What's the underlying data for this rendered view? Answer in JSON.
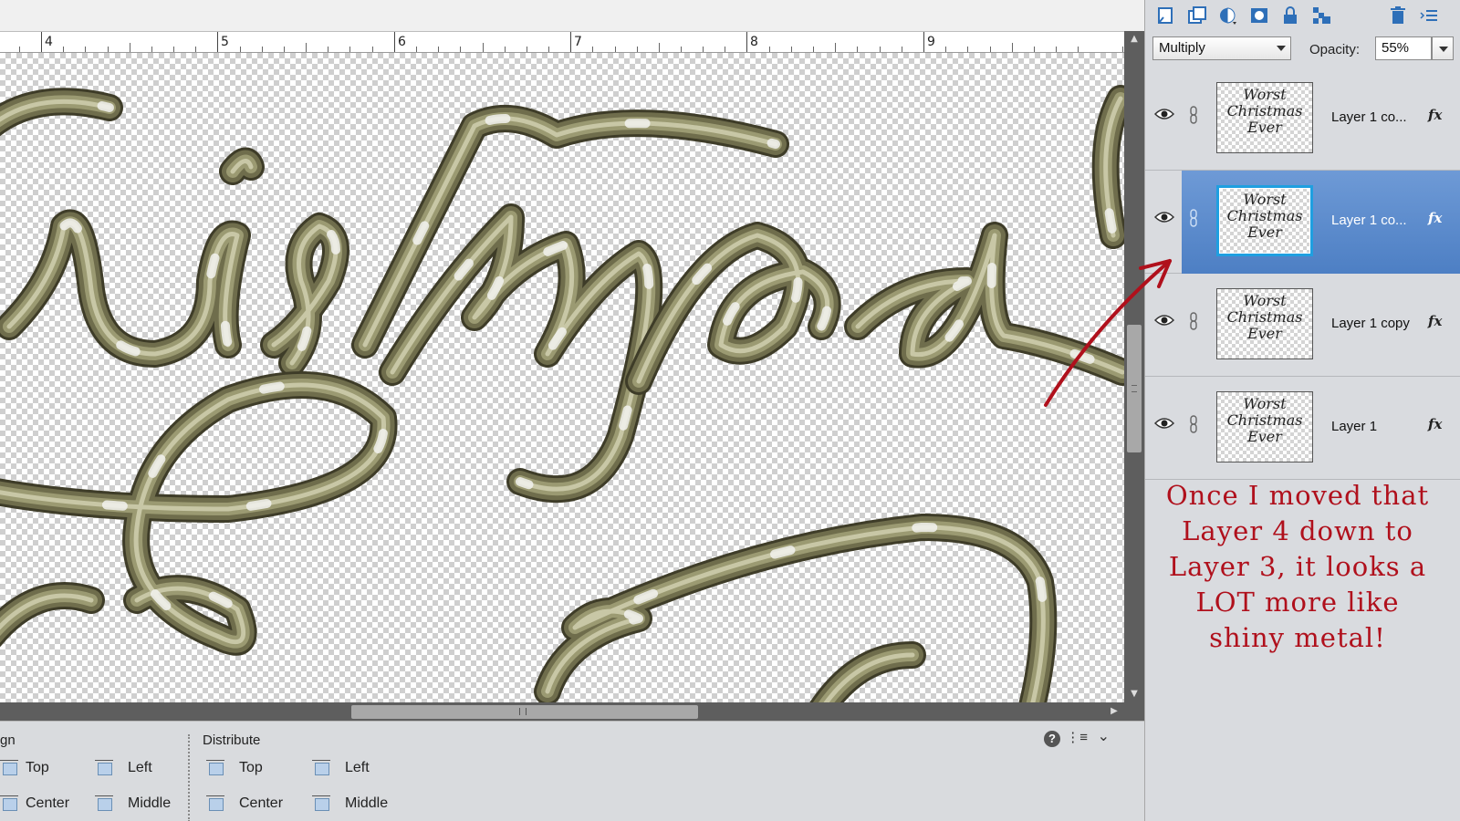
{
  "ruler": {
    "labels": [
      "4",
      "5",
      "6",
      "7",
      "8",
      "9"
    ]
  },
  "tool_options": {
    "align": {
      "title": "gn",
      "items": [
        "Top",
        "Left",
        "Center",
        "Middle"
      ]
    },
    "distribute": {
      "title": "Distribute",
      "items": [
        "Top",
        "Left",
        "Center",
        "Middle"
      ]
    },
    "help_label": "?"
  },
  "layers_panel": {
    "blend_mode": "Multiply",
    "opacity_label": "Opacity:",
    "opacity_value": "55%",
    "layers": [
      {
        "name": "Layer 1 co...",
        "selected": false,
        "fx": "fx"
      },
      {
        "name": "Layer 1 co...",
        "selected": true,
        "fx": "fx"
      },
      {
        "name": "Layer 1 copy",
        "selected": false,
        "fx": "fx"
      },
      {
        "name": "Layer 1",
        "selected": false,
        "fx": "fx"
      }
    ],
    "thumbnail_text": [
      "Worst",
      "Christmas",
      "Ever"
    ]
  },
  "annotation": {
    "lines": [
      "Once I moved that",
      "Layer 4 down to",
      "Layer 3, it looks a",
      "LOT more like",
      "shiny metal!"
    ],
    "color": "#b0101c"
  },
  "colors": {
    "selection": "#4d7fc4",
    "accent_icon": "#2e6fb8",
    "metal": "#7a7a58"
  }
}
